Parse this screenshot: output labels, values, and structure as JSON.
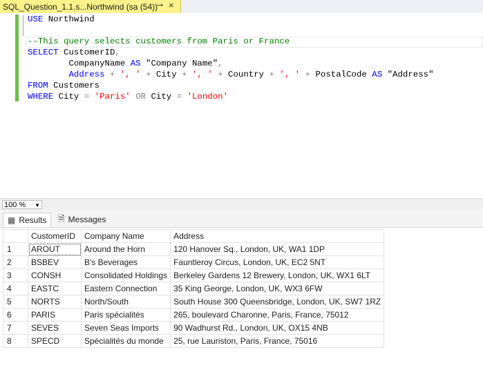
{
  "tab": {
    "title": "SQL_Question_1.1.s...Northwind (sa (54))",
    "pin_icon": "pin-icon",
    "close_icon": "close-icon"
  },
  "editor": {
    "lines": [
      {
        "parts": [
          [
            "kw",
            "USE"
          ],
          [
            "pl",
            " Northwind"
          ]
        ]
      },
      {
        "parts": []
      },
      {
        "parts": [
          [
            "cm",
            "--This query selects customers from Paris or France"
          ]
        ]
      },
      {
        "parts": [
          [
            "kw",
            "SELECT"
          ],
          [
            "pl",
            " CustomerID"
          ],
          [
            "op",
            ","
          ]
        ]
      },
      {
        "parts": [
          [
            "pl",
            "        CompanyName "
          ],
          [
            "kw",
            "AS"
          ],
          [
            "pl",
            " \"Company Name\""
          ],
          [
            "op",
            ","
          ]
        ]
      },
      {
        "parts": [
          [
            "pl",
            "        "
          ],
          [
            "kw",
            "Address"
          ],
          [
            "pl",
            " "
          ],
          [
            "op",
            "+"
          ],
          [
            "pl",
            " "
          ],
          [
            "st",
            "', '"
          ],
          [
            "pl",
            " "
          ],
          [
            "op",
            "+"
          ],
          [
            "pl",
            " City "
          ],
          [
            "op",
            "+"
          ],
          [
            "pl",
            " "
          ],
          [
            "st",
            "', '"
          ],
          [
            "pl",
            " "
          ],
          [
            "op",
            "+"
          ],
          [
            "pl",
            " Country "
          ],
          [
            "op",
            "+"
          ],
          [
            "pl",
            " "
          ],
          [
            "st",
            "', '"
          ],
          [
            "pl",
            " "
          ],
          [
            "op",
            "+"
          ],
          [
            "pl",
            " PostalCode "
          ],
          [
            "kw",
            "AS"
          ],
          [
            "pl",
            " \"Address\""
          ]
        ]
      },
      {
        "parts": [
          [
            "kw",
            "FROM"
          ],
          [
            "pl",
            " Customers"
          ]
        ]
      },
      {
        "parts": [
          [
            "kw",
            "WHERE"
          ],
          [
            "pl",
            " City "
          ],
          [
            "op",
            "="
          ],
          [
            "pl",
            " "
          ],
          [
            "st",
            "'Paris'"
          ],
          [
            "pl",
            " "
          ],
          [
            "op",
            "OR"
          ],
          [
            "pl",
            " City "
          ],
          [
            "op",
            "="
          ],
          [
            "pl",
            " "
          ],
          [
            "st",
            "'London'"
          ]
        ]
      }
    ]
  },
  "zoom": {
    "value": "100 %"
  },
  "results_tabs": {
    "results": "Results",
    "messages": "Messages"
  },
  "grid": {
    "columns": [
      "CustomerID",
      "Company Name",
      "Address"
    ],
    "rows": [
      [
        "1",
        "AROUT",
        "Around the Horn",
        "120 Hanover Sq., London, UK, WA1 1DP"
      ],
      [
        "2",
        "BSBEV",
        "B's Beverages",
        "Fauntleroy Circus, London, UK, EC2 5NT"
      ],
      [
        "3",
        "CONSH",
        "Consolidated Holdings",
        "Berkeley Gardens 12  Brewery, London, UK, WX1 6LT"
      ],
      [
        "4",
        "EASTC",
        "Eastern Connection",
        "35 King George, London, UK, WX3 6FW"
      ],
      [
        "5",
        "NORTS",
        "North/South",
        "South House 300 Queensbridge, London, UK, SW7 1RZ"
      ],
      [
        "6",
        "PARIS",
        "Paris spécialités",
        "265, boulevard Charonne, Paris, France, 75012"
      ],
      [
        "7",
        "SEVES",
        "Seven Seas Imports",
        "90 Wadhurst Rd., London, UK, OX15 4NB"
      ],
      [
        "8",
        "SPECD",
        "Spécialités du monde",
        "25, rue Lauriston, Paris, France, 75016"
      ]
    ]
  }
}
